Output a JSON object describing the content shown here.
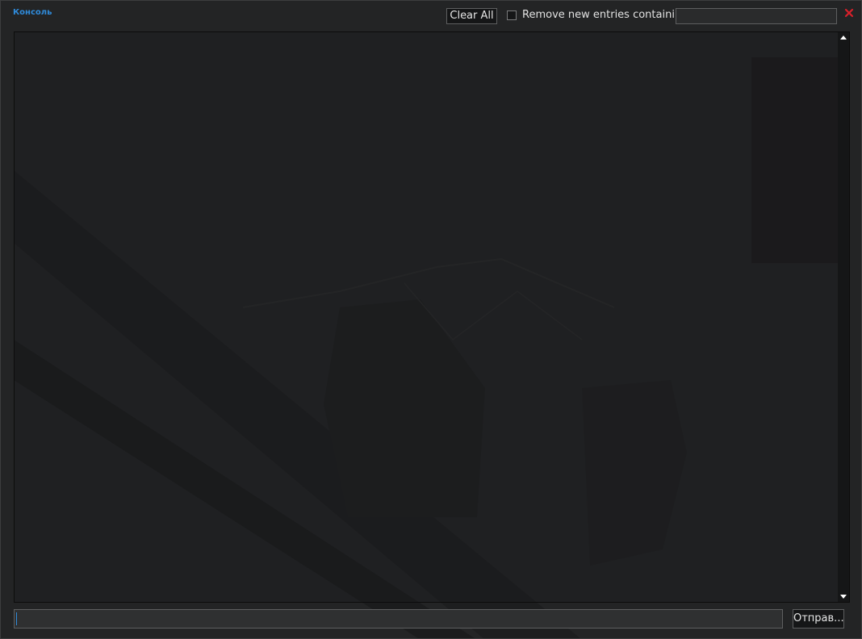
{
  "window": {
    "title": "Консоль"
  },
  "toolbar": {
    "clear_label": "Clear All",
    "filter_label": "Remove new entries containing:",
    "filter_value": "",
    "filter_checked": false
  },
  "footer": {
    "command_value": "",
    "submit_label": "Отправ..."
  },
  "icons": {
    "close": "close-icon",
    "scroll_up": "arrow-up-icon",
    "scroll_down": "arrow-down-icon"
  },
  "colors": {
    "title": "#2f8bdb",
    "close": "#d9202a",
    "panel": "#242526",
    "text": "#e6e6e6"
  }
}
